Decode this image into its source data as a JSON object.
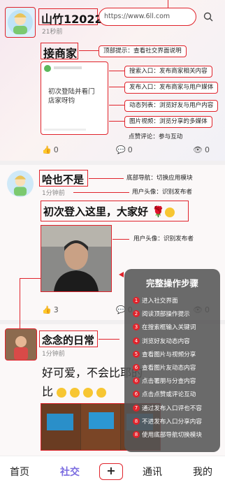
{
  "top_post": {
    "username": "山竹12022",
    "url": "https://www.6ll.com",
    "time": "21秒前",
    "title": "接商家",
    "card_text": "初次登陆并看门店家呀钧",
    "likes": "0",
    "comments": "0",
    "views": "0"
  },
  "post2": {
    "username": "哈也不是",
    "time": "1分钟前",
    "content": "初次登入这里，大家好",
    "likes": "3",
    "comments": "0",
    "views": "0"
  },
  "post3": {
    "username": "念念的日常",
    "time": "1分钟前",
    "content_line1": "好可爱，不会比耶的",
    "content_line2": "比"
  },
  "callouts": {
    "c1": "顶部提示：查看社交界面说明",
    "c2": "搜索入口：发布商家相关内容",
    "c3": "发布入口：发布商家与用户媒体",
    "c4": "动态列表：浏览好友与用户内容",
    "c5": "图片视频：浏览分享的多媒体",
    "c6": "点赞评论：参与互动",
    "c7": "底部导航：切换应用模块",
    "c8": "用户头像：识别发布者",
    "c9": "用户头像：识别发布者"
  },
  "panel": {
    "title": "完整操作步骤",
    "steps": [
      {
        "n": "1",
        "text": "进入社交界面"
      },
      {
        "n": "2",
        "text": "阅读顶部操作提示"
      },
      {
        "n": "3",
        "text": "在搜索框输入关键词"
      },
      {
        "n": "4",
        "text": "浏览好友动态内容"
      },
      {
        "n": "5",
        "text": "查看图片与视频分享"
      },
      {
        "n": "6",
        "text": "查看图片友动态内容"
      },
      {
        "n": "6",
        "text": "点击署朋与分查内容"
      },
      {
        "n": "6",
        "text": "点击点赞或评论互动"
      },
      {
        "n": "7",
        "text": "通过发布入口评也不容"
      },
      {
        "n": "8",
        "text": "不进发布入口分享内容"
      },
      {
        "n": "8",
        "text": "使用底部导航切换模块"
      }
    ]
  },
  "nav": {
    "home": "首页",
    "social": "社交",
    "plus": "+",
    "messages": "通讯",
    "mine": "我的"
  },
  "colors": {
    "accent": "#e0232b",
    "active_tab": "#7a6be0"
  }
}
